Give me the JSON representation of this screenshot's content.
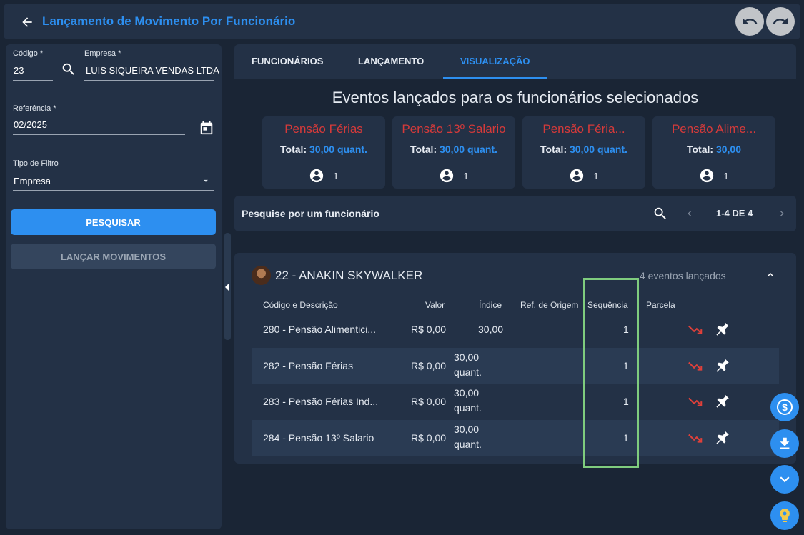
{
  "header": {
    "title": "Lançamento de Movimento Por Funcionário"
  },
  "filters": {
    "codigo_label": "Código *",
    "codigo_value": "23",
    "empresa_label": "Empresa *",
    "empresa_value": "LUIS SIQUEIRA VENDAS LTDA",
    "referencia_label": "Referência *",
    "referencia_value": "02/2025",
    "tipo_filtro_label": "Tipo de Filtro",
    "tipo_filtro_value": "Empresa",
    "pesquisar_label": "PESQUISAR",
    "lancar_label": "LANÇAR MOVIMENTOS"
  },
  "tabs": [
    {
      "label": "FUNCIONÁRIOS"
    },
    {
      "label": "LANÇAMENTO"
    },
    {
      "label": "VISUALIZAÇÃO"
    }
  ],
  "events": {
    "title": "Eventos lançados para os funcionários selecionados",
    "total_label": "Total:",
    "cards": [
      {
        "name": "Pensão Férias",
        "total": "30,00 quant.",
        "count": "1"
      },
      {
        "name": "Pensão 13º Salario",
        "total": "30,00 quant.",
        "count": "1"
      },
      {
        "name": "Pensão Féria...",
        "total": "30,00 quant.",
        "count": "1"
      },
      {
        "name": "Pensão Alime...",
        "total": "30,00",
        "count": "1"
      }
    ]
  },
  "search": {
    "title": "Pesquise por um funcionário",
    "pager": "1-4 DE 4"
  },
  "employee": {
    "name": "22 - ANAKIN SKYWALKER",
    "events_count": "4 eventos lançados",
    "columns": [
      "Código e Descrição",
      "Valor",
      "Índice",
      "Ref. de Origem",
      "Sequência",
      "Parcela"
    ],
    "rows": [
      {
        "desc": "280 - Pensão Alimentici...",
        "valor": "R$ 0,00",
        "indice_1": "30,00",
        "indice_2": "",
        "sequencia": "1"
      },
      {
        "desc": "282 - Pensão Férias",
        "valor": "R$ 0,00",
        "indice_1": "30,00",
        "indice_2": "quant.",
        "sequencia": "1"
      },
      {
        "desc": "283 - Pensão Férias Ind...",
        "valor": "R$ 0,00",
        "indice_1": "30,00",
        "indice_2": "quant.",
        "sequencia": "1"
      },
      {
        "desc": "284 - Pensão 13º Salario",
        "valor": "R$ 0,00",
        "indice_1": "30,00",
        "indice_2": "quant.",
        "sequencia": "1"
      }
    ]
  },
  "colors": {
    "accent": "#2d8ff0",
    "danger": "#d63a3a",
    "highlight": "#7fcc7e",
    "panel": "#233146",
    "background": "#1a2535"
  }
}
